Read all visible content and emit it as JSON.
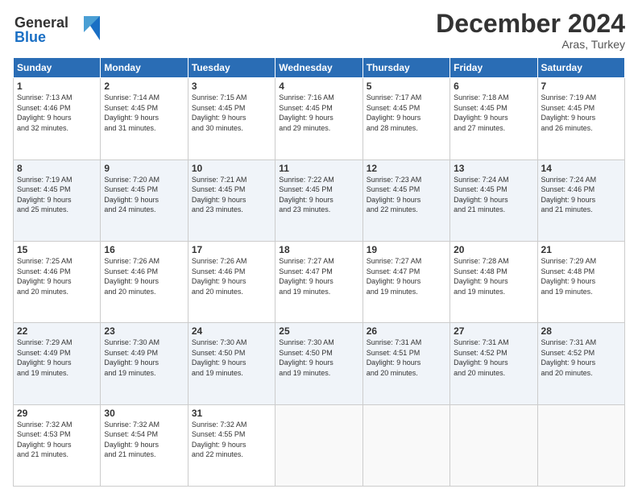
{
  "header": {
    "logo_line1": "General",
    "logo_line2": "Blue",
    "month_title": "December 2024",
    "location": "Aras, Turkey"
  },
  "days_of_week": [
    "Sunday",
    "Monday",
    "Tuesday",
    "Wednesday",
    "Thursday",
    "Friday",
    "Saturday"
  ],
  "weeks": [
    [
      {
        "day": "1",
        "info": "Sunrise: 7:13 AM\nSunset: 4:46 PM\nDaylight: 9 hours\nand 32 minutes."
      },
      {
        "day": "2",
        "info": "Sunrise: 7:14 AM\nSunset: 4:45 PM\nDaylight: 9 hours\nand 31 minutes."
      },
      {
        "day": "3",
        "info": "Sunrise: 7:15 AM\nSunset: 4:45 PM\nDaylight: 9 hours\nand 30 minutes."
      },
      {
        "day": "4",
        "info": "Sunrise: 7:16 AM\nSunset: 4:45 PM\nDaylight: 9 hours\nand 29 minutes."
      },
      {
        "day": "5",
        "info": "Sunrise: 7:17 AM\nSunset: 4:45 PM\nDaylight: 9 hours\nand 28 minutes."
      },
      {
        "day": "6",
        "info": "Sunrise: 7:18 AM\nSunset: 4:45 PM\nDaylight: 9 hours\nand 27 minutes."
      },
      {
        "day": "7",
        "info": "Sunrise: 7:19 AM\nSunset: 4:45 PM\nDaylight: 9 hours\nand 26 minutes."
      }
    ],
    [
      {
        "day": "8",
        "info": "Sunrise: 7:19 AM\nSunset: 4:45 PM\nDaylight: 9 hours\nand 25 minutes."
      },
      {
        "day": "9",
        "info": "Sunrise: 7:20 AM\nSunset: 4:45 PM\nDaylight: 9 hours\nand 24 minutes."
      },
      {
        "day": "10",
        "info": "Sunrise: 7:21 AM\nSunset: 4:45 PM\nDaylight: 9 hours\nand 23 minutes."
      },
      {
        "day": "11",
        "info": "Sunrise: 7:22 AM\nSunset: 4:45 PM\nDaylight: 9 hours\nand 23 minutes."
      },
      {
        "day": "12",
        "info": "Sunrise: 7:23 AM\nSunset: 4:45 PM\nDaylight: 9 hours\nand 22 minutes."
      },
      {
        "day": "13",
        "info": "Sunrise: 7:24 AM\nSunset: 4:45 PM\nDaylight: 9 hours\nand 21 minutes."
      },
      {
        "day": "14",
        "info": "Sunrise: 7:24 AM\nSunset: 4:46 PM\nDaylight: 9 hours\nand 21 minutes."
      }
    ],
    [
      {
        "day": "15",
        "info": "Sunrise: 7:25 AM\nSunset: 4:46 PM\nDaylight: 9 hours\nand 20 minutes."
      },
      {
        "day": "16",
        "info": "Sunrise: 7:26 AM\nSunset: 4:46 PM\nDaylight: 9 hours\nand 20 minutes."
      },
      {
        "day": "17",
        "info": "Sunrise: 7:26 AM\nSunset: 4:46 PM\nDaylight: 9 hours\nand 20 minutes."
      },
      {
        "day": "18",
        "info": "Sunrise: 7:27 AM\nSunset: 4:47 PM\nDaylight: 9 hours\nand 19 minutes."
      },
      {
        "day": "19",
        "info": "Sunrise: 7:27 AM\nSunset: 4:47 PM\nDaylight: 9 hours\nand 19 minutes."
      },
      {
        "day": "20",
        "info": "Sunrise: 7:28 AM\nSunset: 4:48 PM\nDaylight: 9 hours\nand 19 minutes."
      },
      {
        "day": "21",
        "info": "Sunrise: 7:29 AM\nSunset: 4:48 PM\nDaylight: 9 hours\nand 19 minutes."
      }
    ],
    [
      {
        "day": "22",
        "info": "Sunrise: 7:29 AM\nSunset: 4:49 PM\nDaylight: 9 hours\nand 19 minutes."
      },
      {
        "day": "23",
        "info": "Sunrise: 7:30 AM\nSunset: 4:49 PM\nDaylight: 9 hours\nand 19 minutes."
      },
      {
        "day": "24",
        "info": "Sunrise: 7:30 AM\nSunset: 4:50 PM\nDaylight: 9 hours\nand 19 minutes."
      },
      {
        "day": "25",
        "info": "Sunrise: 7:30 AM\nSunset: 4:50 PM\nDaylight: 9 hours\nand 19 minutes."
      },
      {
        "day": "26",
        "info": "Sunrise: 7:31 AM\nSunset: 4:51 PM\nDaylight: 9 hours\nand 20 minutes."
      },
      {
        "day": "27",
        "info": "Sunrise: 7:31 AM\nSunset: 4:52 PM\nDaylight: 9 hours\nand 20 minutes."
      },
      {
        "day": "28",
        "info": "Sunrise: 7:31 AM\nSunset: 4:52 PM\nDaylight: 9 hours\nand 20 minutes."
      }
    ],
    [
      {
        "day": "29",
        "info": "Sunrise: 7:32 AM\nSunset: 4:53 PM\nDaylight: 9 hours\nand 21 minutes."
      },
      {
        "day": "30",
        "info": "Sunrise: 7:32 AM\nSunset: 4:54 PM\nDaylight: 9 hours\nand 21 minutes."
      },
      {
        "day": "31",
        "info": "Sunrise: 7:32 AM\nSunset: 4:55 PM\nDaylight: 9 hours\nand 22 minutes."
      },
      {
        "day": "",
        "info": ""
      },
      {
        "day": "",
        "info": ""
      },
      {
        "day": "",
        "info": ""
      },
      {
        "day": "",
        "info": ""
      }
    ]
  ]
}
